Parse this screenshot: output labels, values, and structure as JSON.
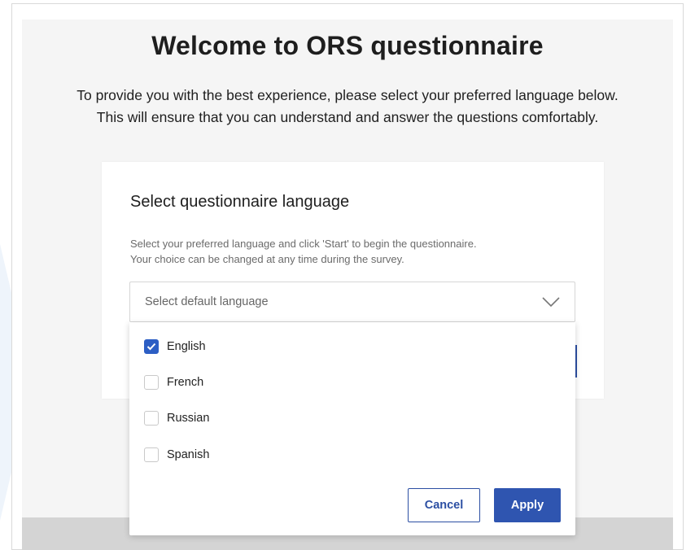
{
  "page": {
    "title": "Welcome to ORS questionnaire",
    "intro_line1": "To provide you with the best experience, please select your preferred language below.",
    "intro_line2": "This will ensure that you can understand and answer the questions comfortably."
  },
  "card": {
    "title": "Select questionnaire language",
    "desc_line1": "Select your preferred language and click 'Start' to begin the questionnaire.",
    "desc_line2": "Your choice can be changed at any time during the survey."
  },
  "language_select": {
    "placeholder": "Select default language",
    "icon": "chevron-down-icon",
    "options": [
      {
        "label": "English",
        "checked": true
      },
      {
        "label": "French",
        "checked": false
      },
      {
        "label": "Russian",
        "checked": false
      },
      {
        "label": "Spanish",
        "checked": false
      }
    ]
  },
  "dropdown_actions": {
    "cancel_label": "Cancel",
    "apply_label": "Apply"
  },
  "colors": {
    "accent": "#2c5ec4",
    "primary_button": "#2f55b0",
    "page_background": "#f5f5f5"
  }
}
